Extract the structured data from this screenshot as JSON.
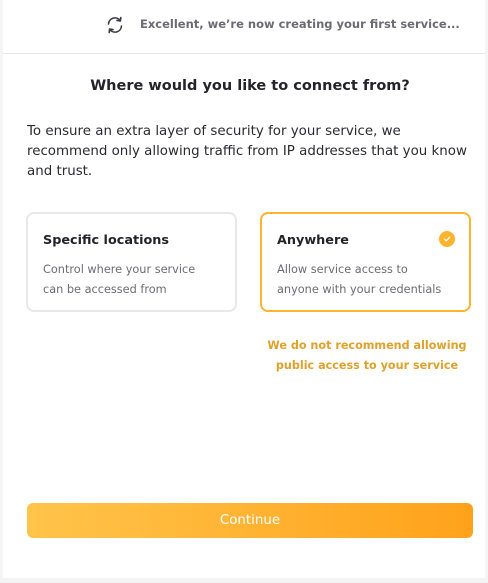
{
  "status": {
    "icon": "sync-icon",
    "text": "Excellent, we’re now creating your first service..."
  },
  "main": {
    "question": "Where would you like to connect from?",
    "description": "To ensure an extra layer of security for your service, we recommend only allowing traffic from IP addresses that you know and trust."
  },
  "options": [
    {
      "title": "Specific locations",
      "description": "Control where your service can be accessed from",
      "selected": false
    },
    {
      "title": "Anywhere",
      "description": "Allow service access to anyone with your credentials",
      "selected": true,
      "icon": "check-circle-icon"
    }
  ],
  "warning": "We do not recommend allowing public access to your service",
  "continue_label": "Continue",
  "colors": {
    "accent": "#fbb42c",
    "warning_text": "#e0a12a",
    "button_gradient_start": "#ffc44b",
    "button_gradient_end": "#ffa21a"
  }
}
